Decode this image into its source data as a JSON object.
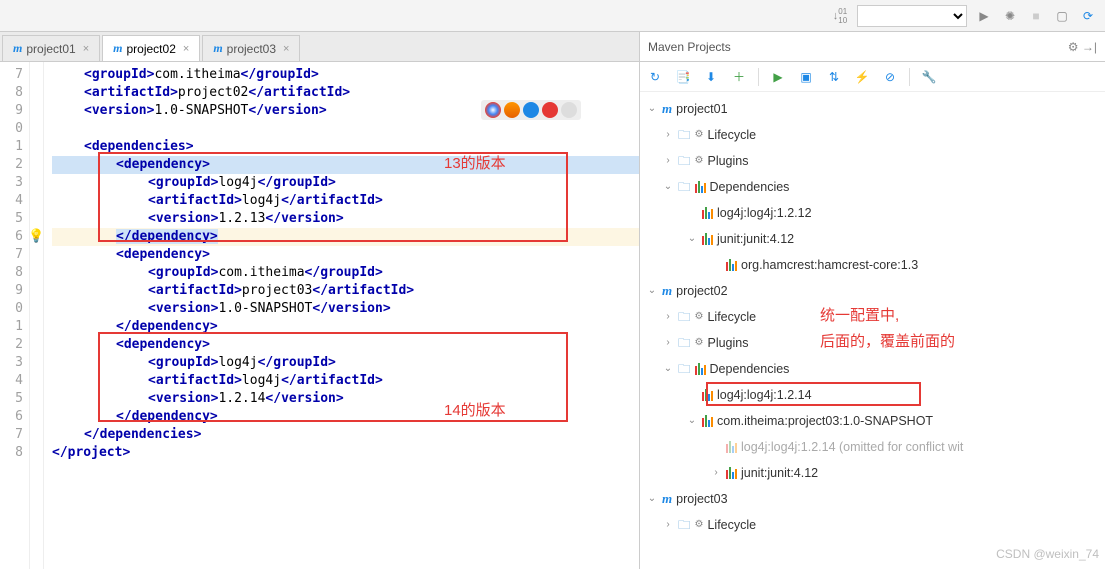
{
  "toolbar": {
    "download_icon": "↓01",
    "run_icon": "▶",
    "debug_icon": "✺",
    "stop_icon": "■",
    "layout_icon": "▣",
    "sync_icon": "⟳"
  },
  "tabs": [
    {
      "label": "project01",
      "active": false
    },
    {
      "label": "project02",
      "active": true
    },
    {
      "label": "project03",
      "active": false
    }
  ],
  "gutter": [
    "7",
    "8",
    "9",
    "0",
    "1",
    "2",
    "3",
    "4",
    "5",
    "6",
    "7",
    "8",
    "9",
    "0",
    "1",
    "2",
    "3",
    "4",
    "5",
    "6",
    "7",
    "8"
  ],
  "code": {
    "l7": {
      "open": "<groupId>",
      "text": "com.itheima",
      "close": "</groupId>"
    },
    "l8": {
      "open": "<artifactId>",
      "text": "project02",
      "close": "</artifactId>"
    },
    "l9": {
      "open": "<version>",
      "text": "1.0-SNAPSHOT",
      "close": "</version>"
    },
    "l11": "<dependencies>",
    "l12": "<dependency>",
    "l13": {
      "open": "<groupId>",
      "text": "log4j",
      "close": "</groupId>"
    },
    "l14": {
      "open": "<artifactId>",
      "text": "log4j",
      "close": "</artifactId>"
    },
    "l15": {
      "open": "<version>",
      "text": "1.2.13",
      "close": "</version>"
    },
    "l16": "</dependency>",
    "l17": "<dependency>",
    "l18": {
      "open": "<groupId>",
      "text": "com.itheima",
      "close": "</groupId>"
    },
    "l19": {
      "open": "<artifactId>",
      "text": "project03",
      "close": "</artifactId>"
    },
    "l20": {
      "open": "<version>",
      "text": "1.0-SNAPSHOT",
      "close": "</version>"
    },
    "l21": "</dependency>",
    "l22": "<dependency>",
    "l23": {
      "open": "<groupId>",
      "text": "log4j",
      "close": "</groupId>"
    },
    "l24": {
      "open": "<artifactId>",
      "text": "log4j",
      "close": "</artifactId>"
    },
    "l25": {
      "open": "<version>",
      "text": "1.2.14",
      "close": "</version>"
    },
    "l26": "</dependency>",
    "l27": "</dependencies>",
    "l28": "</project>"
  },
  "annotations": {
    "box13": "13的版本",
    "box14": "14的版本",
    "mv1": "统一配置中,",
    "mv2": "后面的，覆盖前面的"
  },
  "maven": {
    "title": "Maven Projects",
    "toolbar": {
      "refresh": "↻",
      "add": "+",
      "run": "▶"
    },
    "tree": {
      "p1": "project01",
      "lifecycle": "Lifecycle",
      "plugins": "Plugins",
      "deps": "Dependencies",
      "d_log4j_12": "log4j:log4j:1.2.12",
      "d_junit": "junit:junit:4.12",
      "d_hamcrest": "org.hamcrest:hamcrest-core:1.3",
      "p2": "project02",
      "d_log4j_14": "log4j:log4j:1.2.14",
      "d_proj03": "com.itheima:project03:1.0-SNAPSHOT",
      "d_log4j_omit": "log4j:log4j:1.2.14 (omitted for conflict wit",
      "d_junit2": "junit:junit:4.12",
      "p3": "project03"
    }
  },
  "watermark": "CSDN @weixin_74"
}
